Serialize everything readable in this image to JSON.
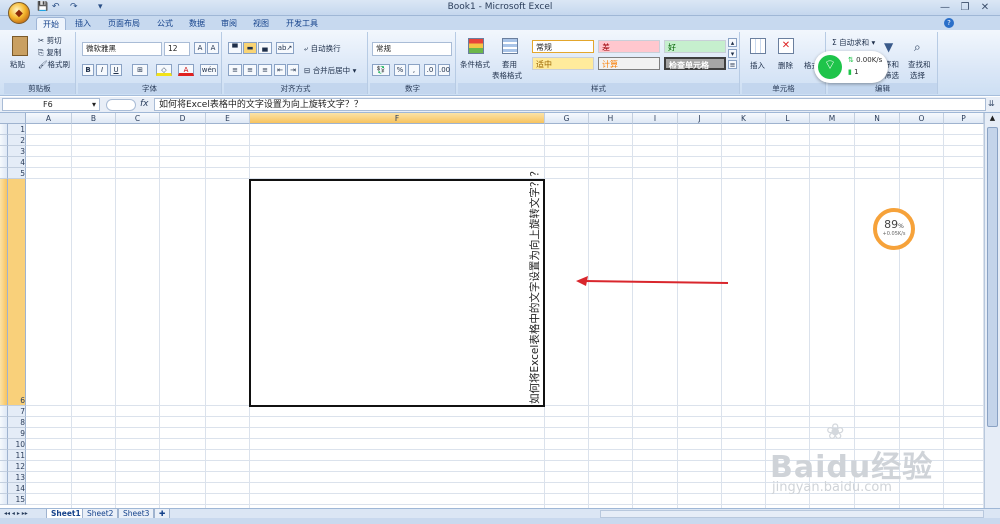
{
  "app": {
    "title": "Book1 - Microsoft Excel"
  },
  "qat": {
    "save": "💾",
    "undo": "↶",
    "redo": "↷",
    "more": "▾"
  },
  "tabs": [
    "开始",
    "插入",
    "页面布局",
    "公式",
    "数据",
    "审阅",
    "视图",
    "开发工具"
  ],
  "ribbon": {
    "clipboard": {
      "paste": "粘贴",
      "cut": "剪切",
      "copy": "复制",
      "format_painter": "格式刷",
      "label": "剪贴板"
    },
    "font": {
      "name": "微软雅黑",
      "size": "12",
      "grow": "A",
      "shrink": "A",
      "bold": "B",
      "italic": "I",
      "underline": "U",
      "font_color": "A",
      "phonetic": "wén",
      "label": "字体"
    },
    "alignment": {
      "wrap": "自动换行",
      "merge": "合并后居中",
      "label": "对齐方式"
    },
    "number": {
      "format": "常规",
      "percent": "%",
      "comma": ",",
      "label": "数字"
    },
    "styles": {
      "conditional": "条件格式",
      "table": "套用",
      "table2": "表格格式",
      "normal": "常规",
      "bad": "差",
      "good": "好",
      "neutral": "适中",
      "calc": "计算",
      "check": "检查单元格",
      "label": "样式"
    },
    "cells": {
      "insert": "插入",
      "delete": "删除",
      "format": "格式",
      "label": "单元格"
    },
    "editing": {
      "autosum": "自动求和",
      "sort": "序和",
      "sort2": "筛选",
      "find": "查找和",
      "find2": "选择",
      "label": "编辑"
    }
  },
  "formula_bar": {
    "name_box": "F6",
    "fx": "fx",
    "content": "如何将Excel表格中的文字设置为向上旋转文字？？"
  },
  "grid": {
    "columns": [
      "A",
      "B",
      "C",
      "D",
      "E",
      "F",
      "G",
      "H",
      "I",
      "J",
      "K",
      "L",
      "M",
      "N",
      "O",
      "P"
    ],
    "rows": [
      "1",
      "2",
      "3",
      "4",
      "5",
      "6",
      "7",
      "8",
      "9",
      "10",
      "11",
      "12",
      "13",
      "14",
      "15"
    ],
    "selected_column": "F",
    "selected_row": "6",
    "cell_f6_text": "如何将Excel表格中的文字设置为向上旋转文字？？"
  },
  "sheets": {
    "nav": "◂◂ ◂ ▸ ▸▸",
    "tabs": [
      "Sheet1",
      "Sheet2",
      "Sheet3"
    ]
  },
  "net_widget": {
    "down": "0.00K/s",
    "up": "1"
  },
  "gauge": {
    "value": "89",
    "unit": "%",
    "rate": "+0.05K/s"
  },
  "watermark": {
    "brand": "Baidu经验",
    "url": "jingyan.baidu.com"
  },
  "colors": {
    "arrow": "#d9262c",
    "wifi": "#1ec44a",
    "gauge": "#f6a23a"
  }
}
